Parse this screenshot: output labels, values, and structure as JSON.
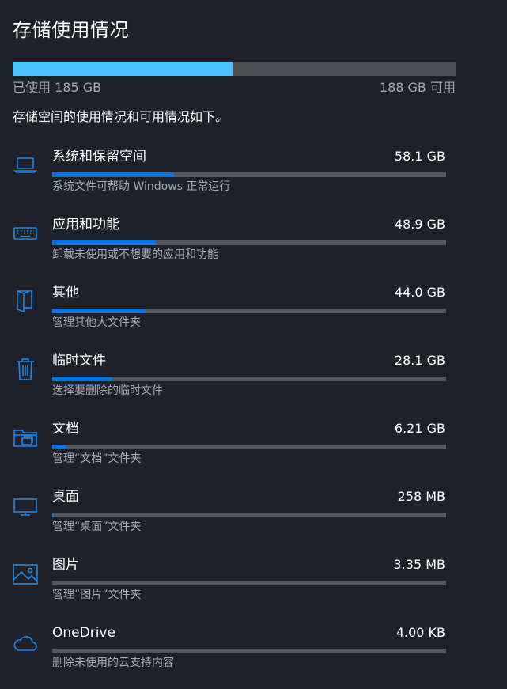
{
  "header": {
    "title": "存储使用情况"
  },
  "summary": {
    "used_label": "已使用 185 GB",
    "free_label": "188 GB 可用",
    "used_fraction": 0.496,
    "description": "存储空间的使用情况和可用情况如下。"
  },
  "colors": {
    "overall_fill": "#4cc2ff",
    "category_fill": "#0a74da",
    "icon": "#1c88e8",
    "track": "#54565c"
  },
  "categories": [
    {
      "name": "系统和保留空间",
      "size": "58.1 GB",
      "description": "系统文件可帮助 Windows 正常运行",
      "icon": "laptop-icon",
      "fraction": 0.31
    },
    {
      "name": "应用和功能",
      "size": "48.9 GB",
      "description": "卸载未使用或不想要的应用和功能",
      "icon": "keyboard-icon",
      "fraction": 0.264
    },
    {
      "name": "其他",
      "size": "44.0 GB",
      "description": "管理其他大文件夹",
      "icon": "folder-open-icon",
      "fraction": 0.237
    },
    {
      "name": "临时文件",
      "size": "28.1 GB",
      "description": "选择要删除的临时文件",
      "icon": "trash-icon",
      "fraction": 0.152
    },
    {
      "name": "文档",
      "size": "6.21 GB",
      "description": "管理“文档”文件夹",
      "icon": "documents-folder-icon",
      "fraction": 0.035
    },
    {
      "name": "桌面",
      "size": "258 MB",
      "description": "管理“桌面”文件夹",
      "icon": "monitor-icon",
      "fraction": 0.004
    },
    {
      "name": "图片",
      "size": "3.35 MB",
      "description": "管理“图片”文件夹",
      "icon": "picture-icon",
      "fraction": 0.0
    },
    {
      "name": "OneDrive",
      "size": "4.00 KB",
      "description": "删除未使用的云支持内容",
      "icon": "cloud-icon",
      "fraction": 0.0
    }
  ]
}
